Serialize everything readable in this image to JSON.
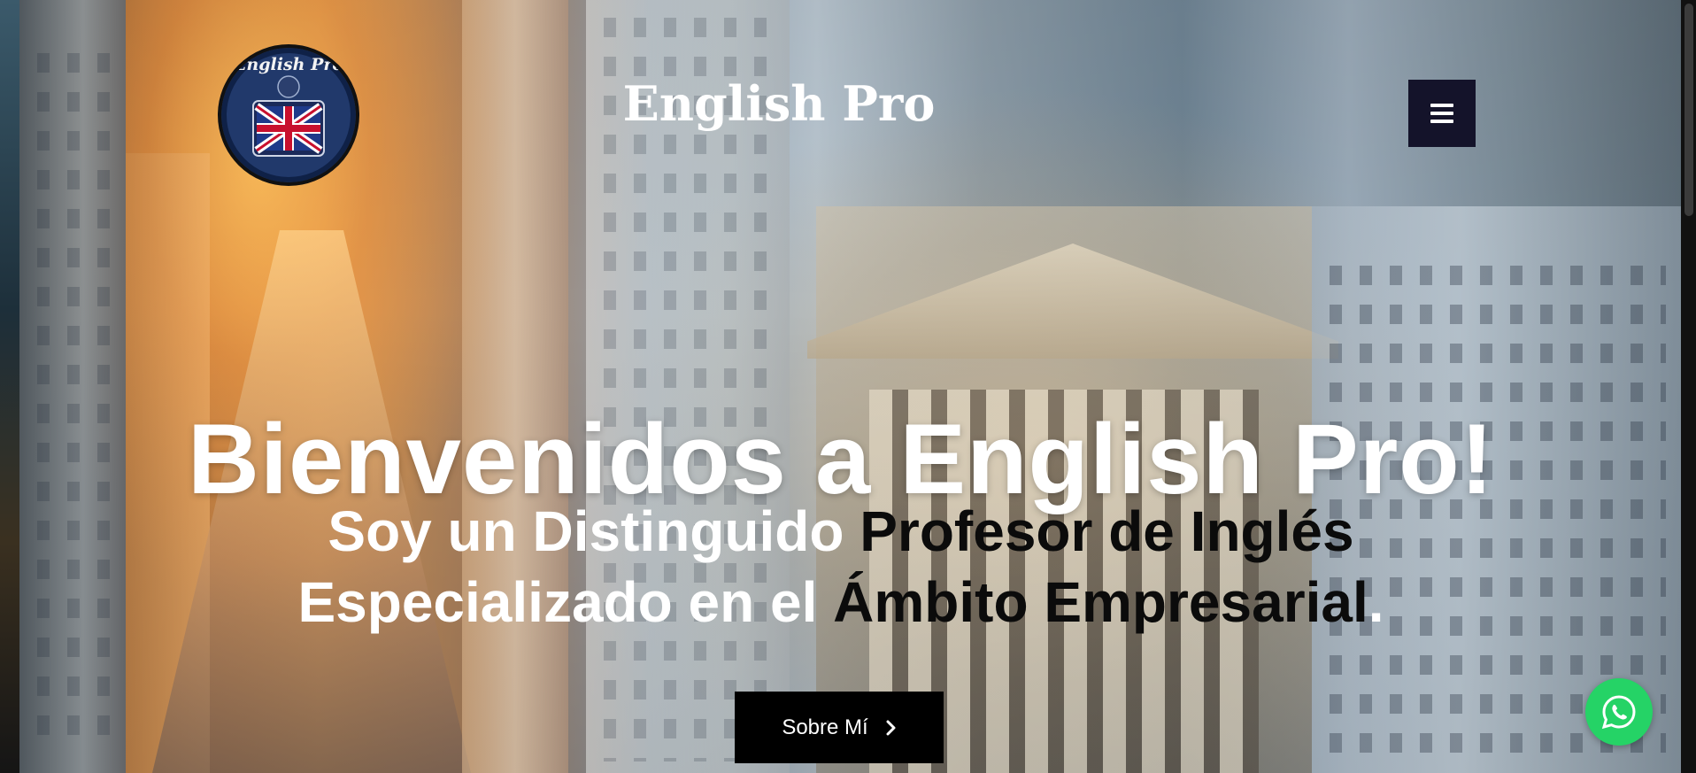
{
  "header": {
    "logo_text": "English Pro",
    "site_title": "English Pro",
    "menu_icon": "hamburger-icon"
  },
  "hero": {
    "title": "Bienvenidos a English Pro!",
    "subtitle_line1_white": "Soy un Distinguido ",
    "subtitle_line1_dark": "Profesor de Inglés",
    "subtitle_line2_white_a": "Especializado en el ",
    "subtitle_line2_dark": "Ámbito Empresarial",
    "subtitle_line2_white_b": ".",
    "cta_label": "Sobre Mí",
    "cta_icon": "chevron-right-icon"
  },
  "floating": {
    "whatsapp_icon": "whatsapp-icon"
  },
  "colors": {
    "menu_button_bg": "#14132a",
    "cta_bg": "#000000",
    "whatsapp_green": "#25d366",
    "subtitle_dark": "#0b0b0b"
  }
}
